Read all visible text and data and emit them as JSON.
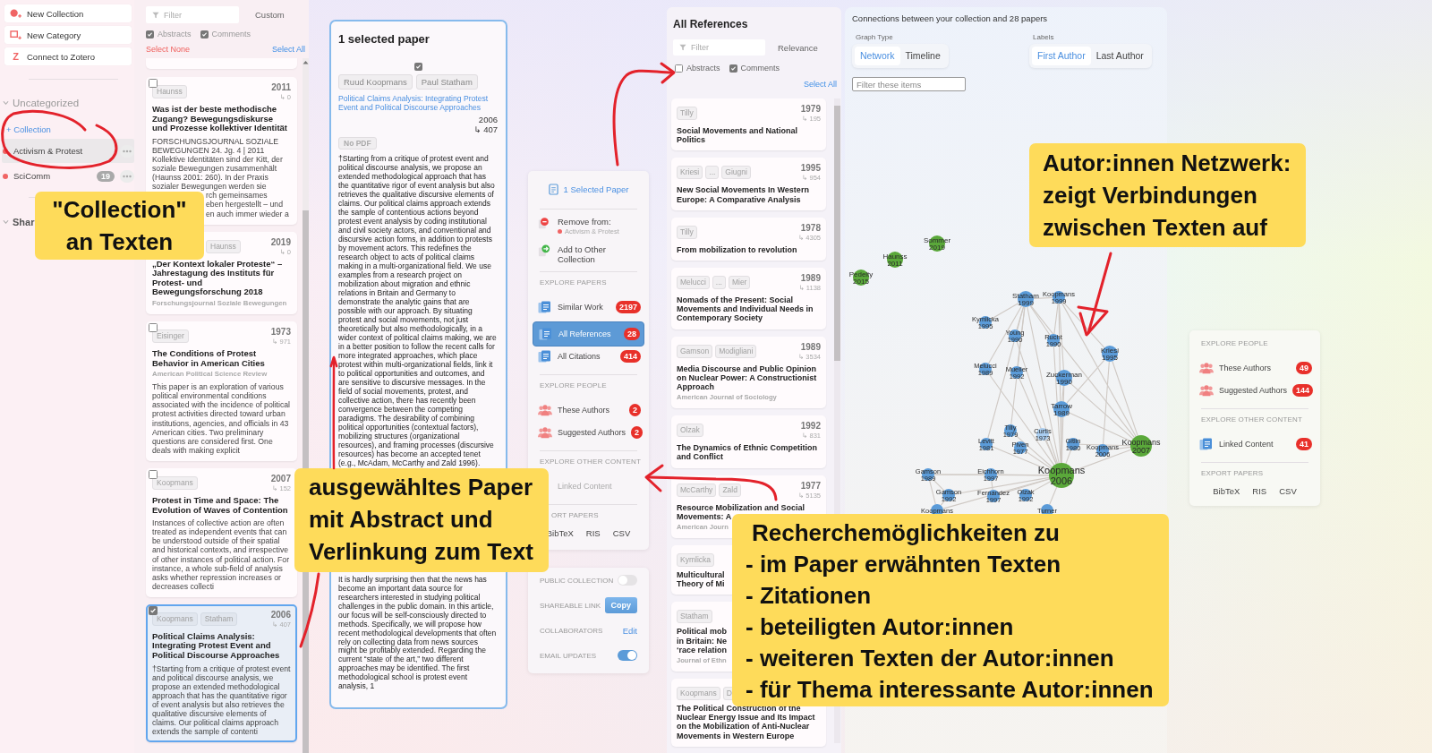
{
  "sidebar": {
    "actions": [
      {
        "label": "New Collection",
        "kind": "collection"
      },
      {
        "label": "New Category",
        "kind": "category"
      },
      {
        "label": "Connect to Zotero",
        "kind": "zotero",
        "mark": "Z"
      }
    ],
    "groups": [
      {
        "title": "Uncategorized",
        "kind": "uncategorized",
        "expanded": true,
        "add_label": "+ Collection",
        "collections": [
          {
            "name": "Activism & Protest",
            "selected": true
          },
          {
            "name": "SciComm",
            "count": "19",
            "selected": false
          }
        ]
      },
      {
        "title": "Shar",
        "kind": "shared",
        "expanded": true
      }
    ]
  },
  "papers": {
    "filter": {
      "placeholder": "Filter"
    },
    "sort": "Custom",
    "toggles": [
      {
        "label": "Abstracts",
        "checked": true
      },
      {
        "label": "Comments",
        "checked": true
      }
    ],
    "select_none": "Select None",
    "select_all": "Select All",
    "cards": [
      {
        "checked": false,
        "selected": false,
        "authors": [
          "Haunss"
        ],
        "year": "2011",
        "citations": "↳ 0",
        "title": "Was ist der beste methodische Zugang? Bewegungsdiskurse und Prozesse kollektiver Identität",
        "abstract": "FORSCHUNGSJOURNAL SOZIALE BEWEGUNGEN 24. Jg. 4 | 2011 Kollektive Identitäten sind der Kitt, der soziale Bewegungen zusammenhält (Haunss 2001: 260). In der Praxis sozialer Bewegungen werden sie",
        "abstract_cut": [
          "rch gemeinsames",
          "eben hergestellt – und",
          "en auch immer wieder a"
        ]
      },
      {
        "covered": true,
        "selected": false,
        "authors": [
          "Haunss"
        ],
        "year": "2019",
        "citations": "↳ 0",
        "title": "„Der Kontext lokaler Proteste“ – Jahrestagung des Instituts für Protest- und Bewegungsforschung 2018",
        "venue": "Forschungsjournal Soziale Bewegungen"
      },
      {
        "checked": false,
        "selected": false,
        "authors": [
          "Eisinger"
        ],
        "year": "1973",
        "citations": "↳ 971",
        "title": "The Conditions of Protest Behavior in American Cities",
        "venue": "American Political Science Review",
        "abstract": "This paper is an exploration of various political environmental conditions associated with the incidence of political protest activities directed toward urban institutions, agencies, and officials in 43 American cities. Two preliminary questions are considered first. One deals with making explicit"
      },
      {
        "checked": false,
        "selected": false,
        "authors": [
          "Koopmans"
        ],
        "year": "2007",
        "citations": "↳ 152",
        "title": "Protest in Time and Space: The Evolution of Waves of Contention",
        "abstract": "Instances of collective action are often treated as independent events that can be understood outside of their spatial and historical contexts, and irrespective of other instances of political action. For instance, a whole sub-field of analysis asks whether repression increases or decreases collecti"
      },
      {
        "checked": true,
        "selected": true,
        "authors": [
          "Koopmans",
          "Statham"
        ],
        "year": "2006",
        "citations": "↳ 407",
        "title": "Political Claims Analysis: Integrating Protest Event and Political Discourse Approaches",
        "abstract": "†Starting from a critique of protest event and political discourse analysis, we propose an extended methodological approach that has the quantitative rigor of event analysis but also retrieves the qualitative discursive elements of claims. Our political claims approach extends the sample of contenti"
      }
    ]
  },
  "detail": {
    "heading": "1 selected paper",
    "checked": true,
    "authors": [
      "Ruud Koopmans",
      "Paul Statham"
    ],
    "title": "Political Claims Analysis: Integrating Protest Event and Political Discourse Approaches",
    "year": "2006",
    "citations": "↳ 407",
    "pdf": "No PDF",
    "abstract": "†Starting from a critique of protest event and political discourse analysis, we propose an extended methodological approach that has the quantitative rigor of event analysis but also retrieves the qualitative discursive elements of claims. Our political claims approach extends the sample of contentious actions beyond protest event analysis by coding institutional and civil society actors, and conventional and discursive action forms, in addition to protests by movement actors. This redefines the research object to acts of political claims making in a multi-organizational field. We use examples from a research project on mobilization about migration and ethnic relations in Britain and Germany to demonstrate the analytic gains that are possible with our approach. By situating protest and social movements, not just theoretically but also methodologically, in a wider context of political claims making, we are in a better position to follow the recent calls for more integrated approaches, which place protest within multi-organizational fields, link it to political opportunities and outcomes, and are sensitive to discursive messages. In the field of social movements, protest, and collective action, there has recently been convergence between the competing paradigms. The desirability of combining political opportunities (contextual factors), mobilizing structures (organizational resources), and framing processes (discursive resources) has become an accepted tenet (e.g., McAdam, McCarthy and Zald 1996).",
    "abstract_continued": "It is hardly surprising then that the news has become an important data source for researchers interested in studying political challenges in the public domain. In this article, our focus will be self-consciously directed to methods. Specifically, we will propose how recent methodological developments that often rely on collecting data from news sources might be profitably extended. Regarding the current “state of the art,” two different approaches may be identified. The first methodological school is protest event analysis, 1"
  },
  "actions": {
    "header": "1 Selected Paper",
    "collection_actions": [
      {
        "label": "Remove from:",
        "kind": "remove",
        "detail": "Activism & Protest"
      },
      {
        "label": "Add to Other Collection",
        "kind": "add"
      }
    ],
    "sections": [
      {
        "title": "EXPLORE PAPERS",
        "kind": "papers",
        "items": [
          {
            "label": "Similar Work",
            "count": "2197",
            "selected": false
          },
          {
            "label": "All References",
            "count": "28",
            "selected": true
          },
          {
            "label": "All Citations",
            "count": "414",
            "selected": false
          }
        ]
      },
      {
        "title": "EXPLORE PEOPLE",
        "kind": "people",
        "items": [
          {
            "label": "These Authors",
            "count": "2",
            "selected": false
          },
          {
            "label": "Suggested Authors",
            "count": "2",
            "selected": false
          }
        ]
      },
      {
        "title": "EXPLORE OTHER CONTENT",
        "kind": "content",
        "items": [
          {
            "label": "Linked Content",
            "disabled": true,
            "covered": true,
            "selected": false
          }
        ]
      },
      {
        "title": "ORT PAPERS",
        "kind": "export",
        "covered": true,
        "formats": [
          "BibTeX",
          "RIS",
          "CSV"
        ]
      }
    ]
  },
  "settings": [
    {
      "label": "PUBLIC COLLECTION",
      "kind": "toggle",
      "on": false
    },
    {
      "label": "SHAREABLE LINK",
      "kind": "button",
      "action": "Copy"
    },
    {
      "label": "COLLABORATORS",
      "kind": "link",
      "action": "Edit"
    },
    {
      "label": "EMAIL UPDATES",
      "kind": "toggle",
      "on": true
    }
  ],
  "references": {
    "title": "All References",
    "filter": {
      "placeholder": "Filter"
    },
    "sort": "Relevance",
    "toggles": [
      {
        "label": "Abstracts",
        "checked": false
      },
      {
        "label": "Comments",
        "checked": true
      }
    ],
    "select_all": "Select All",
    "cards": [
      {
        "authors": [
          "Tilly"
        ],
        "year": "1979",
        "citations": "↳ 195",
        "title": "Social Movements and National Politics"
      },
      {
        "authors": [
          "Kriesi",
          "...",
          "Giugni"
        ],
        "year": "1995",
        "citations": "↳ 954",
        "title": "New Social Movements In Western Europe: A Comparative Analysis"
      },
      {
        "authors": [
          "Tilly"
        ],
        "year": "1978",
        "citations": "↳ 4305",
        "title": "From mobilization to revolution"
      },
      {
        "authors": [
          "Melucci",
          "...",
          "Mier"
        ],
        "year": "1989",
        "citations": "↳ 1138",
        "title": "Nomads of the Present: Social Movements and Individual Needs in Contemporary Society"
      },
      {
        "authors": [
          "Gamson",
          "Modigliani"
        ],
        "year": "1989",
        "citations": "↳ 3534",
        "title": "Media Discourse and Public Opinion on Nuclear Power: A Constructionist Approach",
        "venue": "American Journal of Sociology"
      },
      {
        "authors": [
          "Olzak"
        ],
        "year": "1992",
        "citations": "↳ 831",
        "title": "The Dynamics of Ethnic Competition and Conflict"
      },
      {
        "authors": [
          "McCarthy",
          "Zald"
        ],
        "year": "1977",
        "citations": "↳ 5135",
        "title_parts": [
          "Resource Mobilization and Social",
          "Movements: A"
        ],
        "venue": "American Journ"
      },
      {
        "authors": [
          "Kymlicka"
        ],
        "title_parts": [
          "Multicultural",
          "Theory of Mi"
        ]
      },
      {
        "authors": [
          "Statham"
        ],
        "title_parts": [
          "Political mob",
          "in Britain: Ne",
          "‘race relation"
        ],
        "venue": "Journal of Ethn"
      },
      {
        "authors": [
          "Koopmans",
          "D"
        ],
        "title": "The Political Construction of the Nuclear Energy Issue and Its Impact on the Mobilization of Anti-Nuclear Movements in Western Europe"
      }
    ]
  },
  "network": {
    "caption": "Connections between your collection and 28 papers",
    "graph_type": {
      "label": "Graph Type",
      "options": [
        {
          "label": "Network",
          "selected": true
        },
        {
          "label": "Timeline",
          "selected": false
        }
      ]
    },
    "labels": {
      "label": "Labels",
      "options": [
        {
          "label": "First Author",
          "selected": true
        },
        {
          "label": "Last Author",
          "selected": false
        }
      ]
    },
    "filter": {
      "placeholder": "Filter these items"
    },
    "nodes": [
      {
        "name": "Sommer",
        "year": "2019",
        "kind": "medium",
        "color": "#5aa83a"
      },
      {
        "name": "Haunss",
        "year": "2011",
        "kind": "medium",
        "color": "#5aa83a"
      },
      {
        "name": "Pedelty",
        "year": "2015",
        "kind": "medium",
        "color": "#5aa83a"
      },
      {
        "name": "Statham",
        "year": "1999",
        "kind": "medium",
        "color": "#5b9bd8"
      },
      {
        "name": "Koopmans",
        "year": "1999",
        "kind": "small",
        "color": "#5b9bd8"
      },
      {
        "name": "Kymlicka",
        "year": "1995",
        "kind": "small",
        "color": "#5b9bd8"
      },
      {
        "name": "Young",
        "year": "1990",
        "kind": "small",
        "color": "#5b9bd8"
      },
      {
        "name": "Rucht",
        "year": "1990",
        "kind": "small",
        "color": "#5b9bd8"
      },
      {
        "name": "Kriesi",
        "year": "1995",
        "kind": "medium",
        "color": "#5b9bd8"
      },
      {
        "name": "Melucci",
        "year": "1989",
        "kind": "small",
        "color": "#5b9bd8"
      },
      {
        "name": "Mueller",
        "year": "1992",
        "kind": "small",
        "color": "#5b9bd8"
      },
      {
        "name": "Zuckerman",
        "year": "1990",
        "kind": "medium",
        "color": "#5b9bd8"
      },
      {
        "name": "Tarrow",
        "year": "1989",
        "kind": "medium",
        "color": "#5b9bd8"
      },
      {
        "name": "Tilly",
        "year": "1979",
        "kind": "small",
        "color": "#5b9bd8"
      },
      {
        "name": "Curtis",
        "year": "1973",
        "kind": "small",
        "color": "#a9cdf0"
      },
      {
        "name": "Levitt",
        "year": "1981",
        "kind": "small",
        "color": "#5b9bd8"
      },
      {
        "name": "Piven",
        "year": "1977",
        "kind": "small",
        "color": "#5b9bd8"
      },
      {
        "name": "Gitlin",
        "year": "1980",
        "kind": "small",
        "color": "#5b9bd8"
      },
      {
        "name": "Koopmans",
        "year": "2006",
        "kind": "small",
        "color": "#5b9bd8"
      },
      {
        "name": "Koopmans",
        "year": "2007",
        "kind": "large",
        "color": "#5aa83a"
      },
      {
        "name": "Gamson",
        "year": "1989",
        "kind": "small",
        "color": "#5b9bd8"
      },
      {
        "name": "Eichhorn",
        "year": "1997",
        "kind": "small",
        "color": "#5b9bd8"
      },
      {
        "name": "Koopmans",
        "year": "2006",
        "kind": "xl",
        "color": "#5aa83a"
      },
      {
        "name": "Gamson",
        "year": "1992",
        "kind": "small",
        "color": "#5b9bd8"
      },
      {
        "name": "Fernandez",
        "year": "1997",
        "kind": "small",
        "color": "#5b9bd8"
      },
      {
        "name": "Olzak",
        "year": "1992",
        "kind": "small",
        "color": "#5b9bd8"
      },
      {
        "name": "Koopmans",
        "kind": "small",
        "color": "#5b9bd8"
      },
      {
        "name": "Turner",
        "kind": "small",
        "color": "#5b9bd8"
      }
    ]
  },
  "right_panel": {
    "sections": [
      {
        "title": "EXPLORE PEOPLE",
        "kind": "people",
        "items": [
          {
            "label": "These Authors",
            "count": "49",
            "selected": false
          },
          {
            "label": "Suggested Authors",
            "count": "144",
            "selected": false
          }
        ]
      },
      {
        "title": "EXPLORE OTHER CONTENT",
        "kind": "content",
        "items": [
          {
            "label": "Linked Content",
            "count": "41",
            "selected": false
          }
        ]
      },
      {
        "title": "EXPORT PAPERS",
        "kind": "export",
        "formats": [
          "BibTeX",
          "RIS",
          "CSV"
        ]
      }
    ]
  },
  "notes": [
    {
      "text": "\"Collection\" an Texten"
    },
    {
      "text": "ausgewähltes Paper mit Abstract und Verlinkung zum Text"
    },
    {
      "text": "Autor:innen Netzwerk: zeigt Verbindungen zwischen Texten auf"
    },
    {
      "heading": "Recherchemöglichkeiten zu",
      "points": [
        "- im Paper erwähnten Texten",
        "- Zitationen",
        "- beteiligten Autor:innen",
        "- weiteren Texten der Autor:innen",
        "- für Thema interessante Autor:innen"
      ]
    }
  ]
}
